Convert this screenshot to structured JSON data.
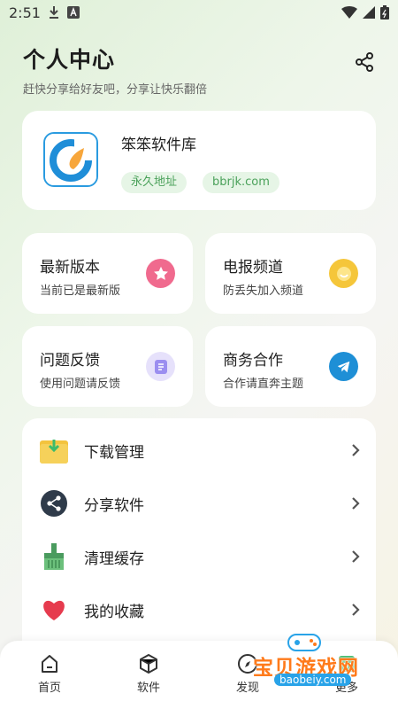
{
  "status_bar": {
    "time": "2:51"
  },
  "header": {
    "title": "个人中心",
    "subtitle": "赶快分享给好友吧，分享让快乐翻倍"
  },
  "app_card": {
    "name": "笨笨软件库",
    "tags": [
      "永久地址",
      "bbrjk.com"
    ]
  },
  "tiles": [
    {
      "title": "最新版本",
      "subtitle": "当前已是最新版",
      "icon": "star-badge-icon",
      "color": "#f06a8e"
    },
    {
      "title": "电报频道",
      "subtitle": "防丢失加入频道",
      "icon": "smile-badge-icon",
      "color": "#f5c63a"
    },
    {
      "title": "问题反馈",
      "subtitle": "使用问题请反馈",
      "icon": "feedback-icon",
      "color": "#9b8ef0"
    },
    {
      "title": "商务合作",
      "subtitle": "合作请直奔主题",
      "icon": "telegram-icon",
      "color": "#1e8fd6"
    }
  ],
  "menu": [
    {
      "label": "下载管理",
      "icon": "download-folder-icon"
    },
    {
      "label": "分享软件",
      "icon": "share-icon"
    },
    {
      "label": "清理缓存",
      "icon": "broom-icon"
    },
    {
      "label": "我的收藏",
      "icon": "heart-icon"
    }
  ],
  "tabs": [
    {
      "label": "首页",
      "icon": "home-icon"
    },
    {
      "label": "软件",
      "icon": "cube-icon"
    },
    {
      "label": "发现",
      "icon": "compass-icon"
    },
    {
      "label": "更多",
      "icon": "more-icon"
    }
  ],
  "watermark": {
    "title": "宝贝游戏网",
    "url": "baobeiy.com"
  }
}
